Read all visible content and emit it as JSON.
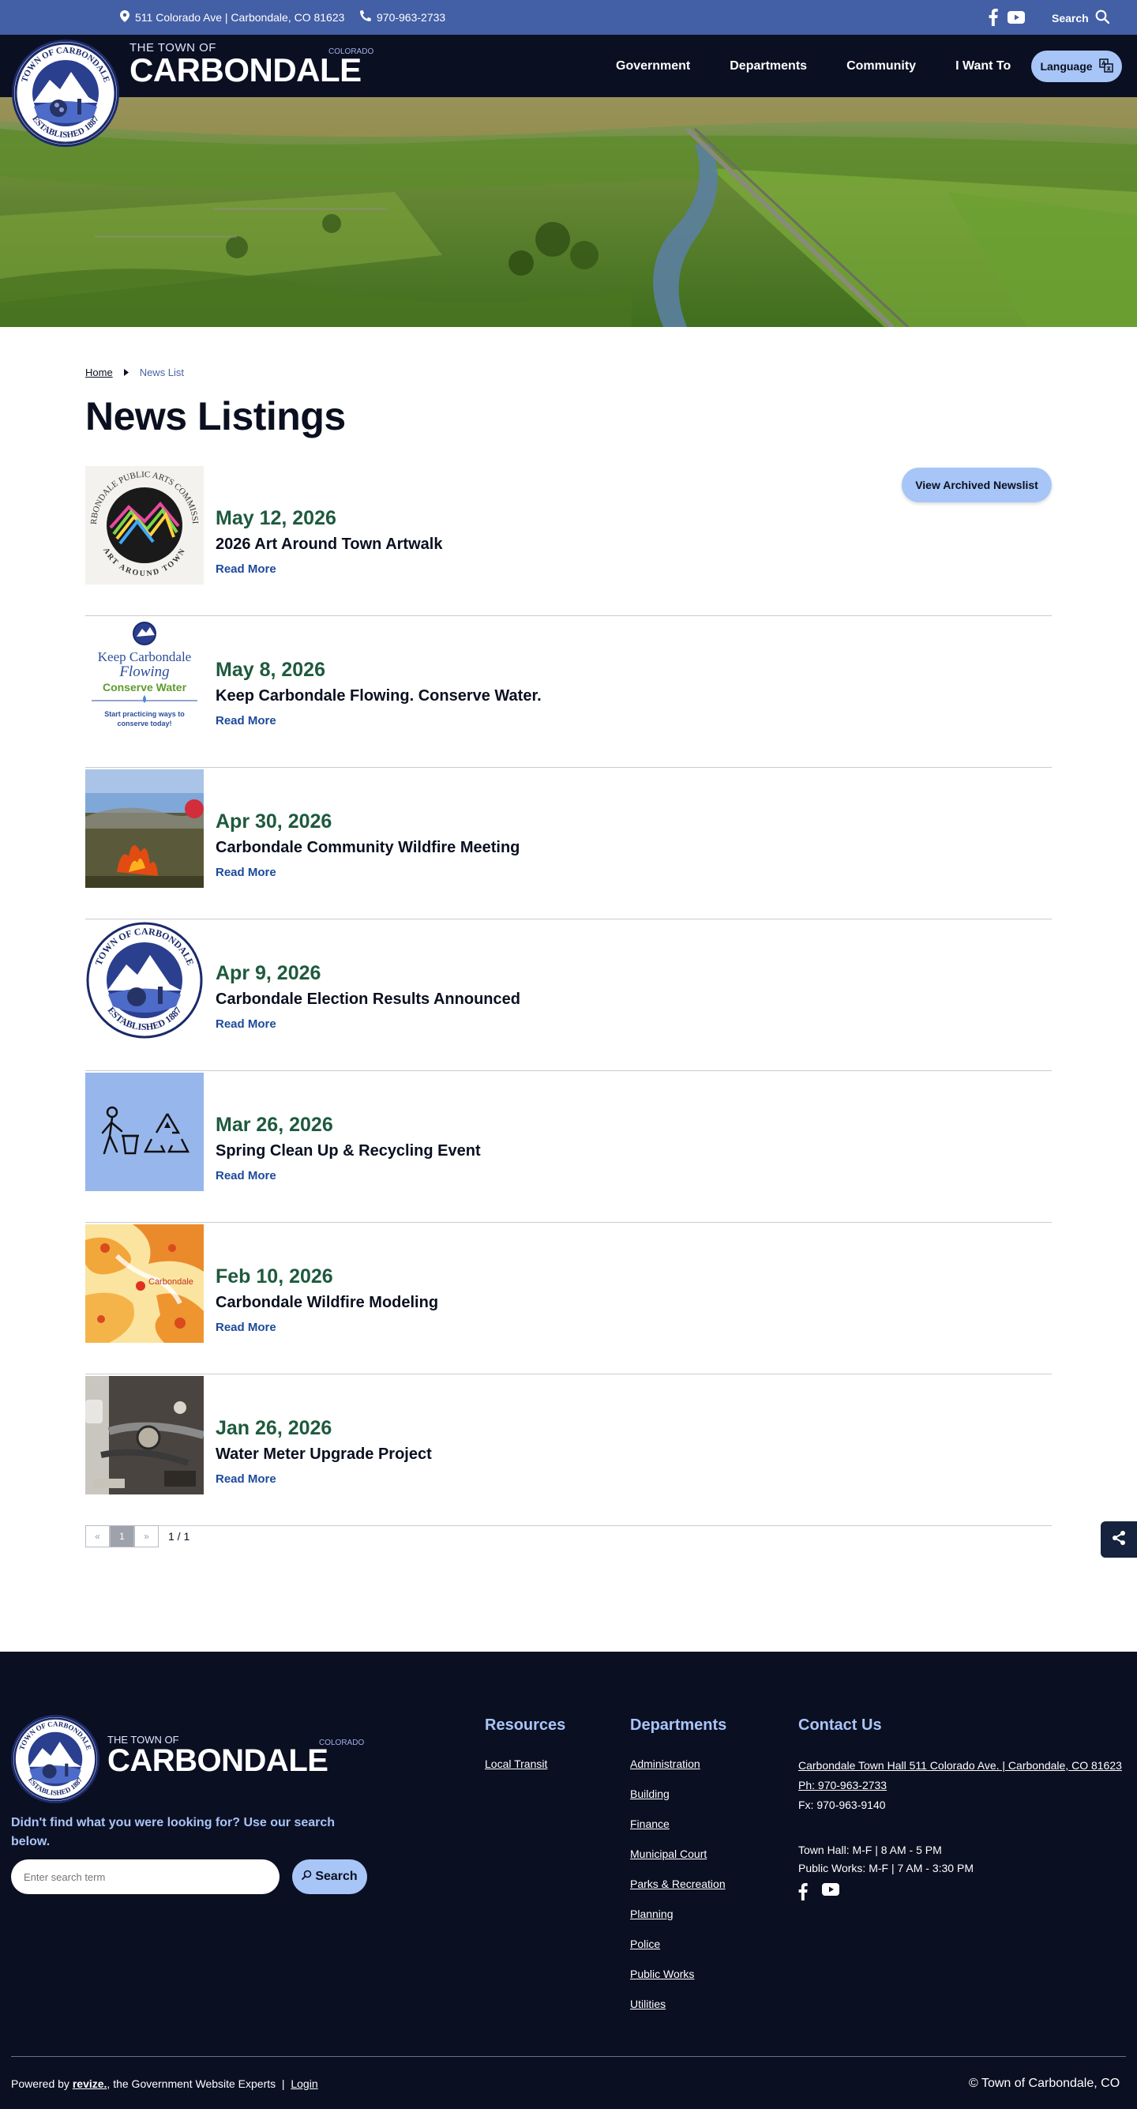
{
  "topbar": {
    "address": "511 Colorado Ave | Carbondale, CO 81623",
    "phone": "970-963-2733",
    "search_label": "Search"
  },
  "brand": {
    "pre": "THE TOWN OF",
    "name": "CARBONDALE",
    "state": "COLORADO"
  },
  "nav": {
    "items": [
      "Government",
      "Departments",
      "Community",
      "I Want To"
    ],
    "language_label": "Language"
  },
  "breadcrumb": {
    "home": "Home",
    "current": "News List"
  },
  "page_title": "News Listings",
  "archived_button": "View Archived Newslist",
  "news": [
    {
      "date": "May 12, 2026",
      "title": "2026 Art Around Town Artwalk",
      "more": "Read More",
      "thumb_icon": "art-commission-logo"
    },
    {
      "date": "May 8, 2026",
      "title": "Keep Carbondale Flowing. Conserve Water.",
      "more": "Read More",
      "thumb_icon": "conserve-water-graphic"
    },
    {
      "date": "Apr 30, 2026",
      "title": "Carbondale Community Wildfire Meeting",
      "more": "Read More",
      "thumb_icon": "wildfire-photo"
    },
    {
      "date": "Apr 9, 2026",
      "title": "Carbondale Election Results Announced",
      "more": "Read More",
      "thumb_icon": "town-seal"
    },
    {
      "date": "Mar 26, 2026",
      "title": "Spring Clean Up & Recycling Event",
      "more": "Read More",
      "thumb_icon": "recycling-icon"
    },
    {
      "date": "Feb 10, 2026",
      "title": "Carbondale Wildfire Modeling",
      "more": "Read More",
      "thumb_icon": "wildfire-map"
    },
    {
      "date": "Jan 26, 2026",
      "title": "Water Meter Upgrade Project",
      "more": "Read More",
      "thumb_icon": "water-meter-photo"
    }
  ],
  "thumb_text": {
    "art_top": "CARBONDALE PUBLIC ARTS COMMISSION",
    "art_bottom": "ART AROUND TOWN",
    "water_line1": "Keep Carbondale",
    "water_line2": "Flowing",
    "water_line3": "Conserve Water",
    "water_line4": "Start practicing ways to",
    "water_line5": "conserve today!",
    "seal_top": "TOWN OF CARBONDALE",
    "seal_bottom": "ESTABLISHED 1887",
    "map_label": "Carbondale"
  },
  "pagination": {
    "prev": "«",
    "page": "1",
    "next": "»",
    "count": "1 / 1"
  },
  "footer": {
    "prompt": "Didn't find what you were looking for? Use our search below.",
    "search_placeholder": "Enter search term",
    "search_button": "Search",
    "resources_title": "Resources",
    "resources": [
      "Local Transit"
    ],
    "departments_title": "Departments",
    "departments": [
      "Administration",
      "Building",
      "Finance",
      "Municipal Court",
      "Parks & Recreation",
      "Planning",
      "Police",
      "Public Works",
      "Utilities"
    ],
    "contact_title": "Contact Us",
    "contact_address": "Carbondale Town Hall 511 Colorado Ave. | Carbondale, CO 81623",
    "contact_phone": "Ph: 970-963-2733",
    "contact_fax": "Fx: 970-963-9140",
    "hours_town_hall": "Town Hall: M-F | 8 AM - 5 PM",
    "hours_public_works": "Public Works: M-F | 7 AM - 3:30 PM",
    "powered_prefix": "Powered by",
    "powered_brand": "revize.",
    "powered_suffix": ", the Government Website Experts",
    "login": "Login",
    "copyright": "© Town of Carbondale, CO"
  },
  "colors": {
    "topbar": "#435fa5",
    "navy": "#0b0f22",
    "accent": "#a8c5f7",
    "date_green": "#1e5a3e",
    "link_blue": "#1c4a9a"
  }
}
